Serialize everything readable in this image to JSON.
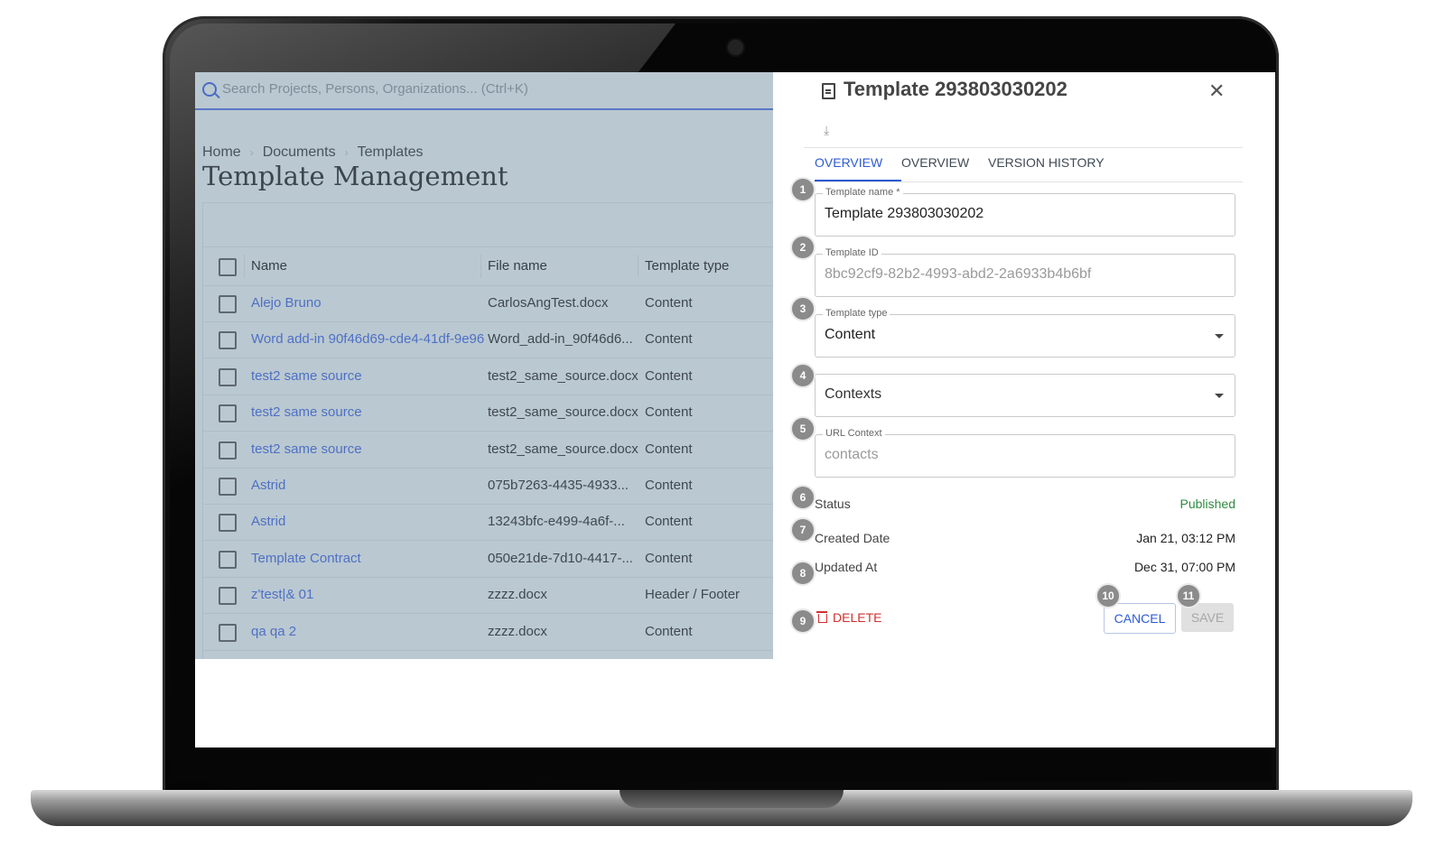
{
  "search": {
    "placeholder": "Search Projects, Persons, Organizations... (Ctrl+K)"
  },
  "breadcrumb": [
    "Home",
    "Documents",
    "Templates"
  ],
  "page_title": "Template Management",
  "table": {
    "columns": [
      "Name",
      "File name",
      "Template type"
    ],
    "rows": [
      {
        "name": "Alejo Bruno",
        "file": "CarlosAngTest.docx",
        "type": "Content"
      },
      {
        "name": "Word add-in 90f46d69-cde4-41df-9e96",
        "file": "Word_add-in_90f46d6...",
        "type": "Content"
      },
      {
        "name": "test2 same source",
        "file": "test2_same_source.docx",
        "type": "Content"
      },
      {
        "name": "test2 same source",
        "file": "test2_same_source.docx",
        "type": "Content"
      },
      {
        "name": "test2 same source",
        "file": "test2_same_source.docx",
        "type": "Content"
      },
      {
        "name": "Astrid",
        "file": "075b7263-4435-4933...",
        "type": "Content"
      },
      {
        "name": "Astrid",
        "file": "13243bfc-e499-4a6f-...",
        "type": "Content"
      },
      {
        "name": "Template Contract",
        "file": "050e21de-7d10-4417-...",
        "type": "Content"
      },
      {
        "name": "z'test|& 01",
        "file": "zzzz.docx",
        "type": "Header / Footer"
      },
      {
        "name": "qa qa 2",
        "file": "zzzz.docx",
        "type": "Content"
      }
    ]
  },
  "panel": {
    "title": "Template 293803030202",
    "tabs": [
      "OVERVIEW",
      "OVERVIEW",
      "VERSION HISTORY"
    ],
    "fields": {
      "template_name": {
        "label": "Template name *",
        "value": "Template 293803030202"
      },
      "template_id": {
        "label": "Template ID",
        "value": "8bc92cf9-82b2-4993-abd2-2a6933b4b6bf"
      },
      "template_type": {
        "label": "Template type",
        "value": "Content"
      },
      "contexts": {
        "value": "Contexts"
      },
      "url_context": {
        "label": "URL Context",
        "value": "contacts"
      }
    },
    "status": {
      "label": "Status",
      "value": "Published"
    },
    "created": {
      "label": "Created Date",
      "value": "Jan 21, 03:12 PM"
    },
    "updated": {
      "label": "Updated At",
      "value": "Dec 31, 07:00 PM"
    },
    "delete_label": "DELETE",
    "cancel_label": "CANCEL",
    "save_label": "SAVE"
  },
  "badges": [
    "1",
    "2",
    "3",
    "4",
    "5",
    "6",
    "7",
    "8",
    "9",
    "10",
    "11"
  ],
  "icons": {
    "search": "search-icon",
    "doc": "document-icon",
    "close": "close-icon",
    "download": "download-icon",
    "trash": "trash-icon",
    "caret": "chevron-down-icon"
  },
  "colors": {
    "accent": "#2e5bd4",
    "link": "#4e70c4",
    "published": "#2e8b3f",
    "delete": "#d32f2f",
    "overlay": "#bac8d1"
  }
}
